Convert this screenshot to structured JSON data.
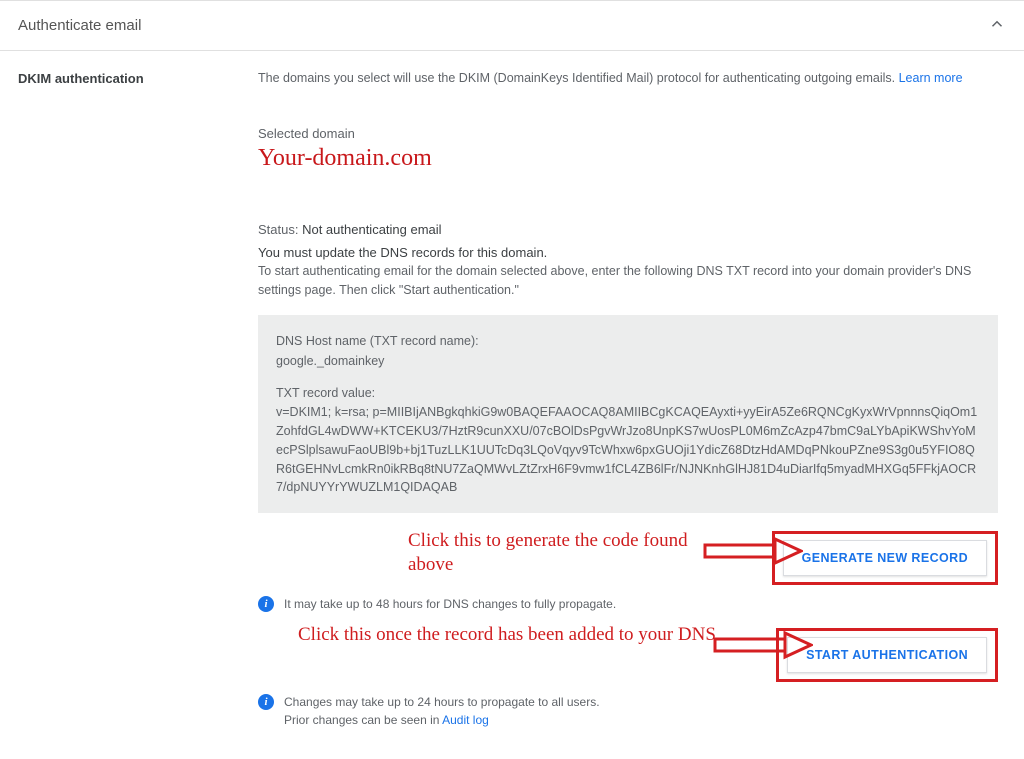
{
  "section": {
    "title": "Authenticate email"
  },
  "left": {
    "heading": "DKIM authentication"
  },
  "intro": {
    "text": "The domains you select will use the DKIM (DomainKeys Identified Mail) protocol for authenticating outgoing emails.",
    "learn_more": "Learn more"
  },
  "selected": {
    "label": "Selected domain",
    "domain": "Your-domain.com"
  },
  "status": {
    "label": "Status:",
    "value": "Not authenticating email"
  },
  "update": {
    "heading": "You must update the DNS records for this domain.",
    "instruction": "To start authenticating email for the domain selected above, enter the following DNS TXT record into your domain provider's DNS settings page. Then click \"Start authentication.\""
  },
  "dns": {
    "host_label": "DNS Host name (TXT record name):",
    "host_value": "google._domainkey",
    "txt_label": "TXT record value:",
    "txt_value": "v=DKIM1; k=rsa; p=MIIBIjANBgkqhkiG9w0BAQEFAAOCAQ8AMIIBCgKCAQEAyxti+yyEirA5Ze6RQNCgKyxWrVpnnnsQiqOm1ZohfdGL4wDWW+KTCEKU3/7HztR9cunXXU/07cBOlDsPgvWrJzo8UnpKS7wUosPL0M6mZcAzp47bmC9aLYbApiKWShvYoMecPSlplsawuFaoUBl9b+bj1TuzLLK1UUTcDq3LQoVqyv9TcWhxw6pxGUOji1YdicZ68DtzHdAMDqPNkouPZne9S3g0u5YFIO8QR6tGEHNvLcmkRn0ikRBq8tNU7ZaQMWvLZtZrxH6F9vmw1fCL4ZB6lFr/NJNKnhGlHJ81D4uDiarIfq5myadMHXGq5FFkjAOCR7/dpNUYYrYWUZLM1QIDAQAB"
  },
  "annotations": {
    "generate": "Click this to generate the code found above",
    "start": "Click this once the record has been added to your DNS"
  },
  "buttons": {
    "generate": "GENERATE NEW RECORD",
    "start": "START AUTHENTICATION"
  },
  "info": {
    "propagate48": "It may take up to 48 hours for DNS changes to fully propagate.",
    "propagate24_line1": "Changes may take up to 24 hours to propagate to all users.",
    "propagate24_line2_prefix": "Prior changes can be seen in ",
    "audit_log": "Audit log"
  }
}
